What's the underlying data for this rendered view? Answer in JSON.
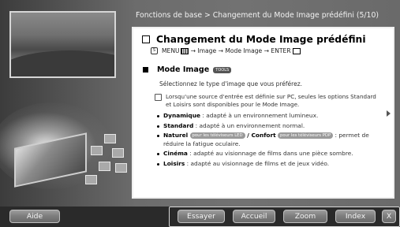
{
  "header": {
    "breadcrumb": "Fonctions de base > Changement du Mode Image prédéfini (5/10)"
  },
  "content": {
    "title": "Changement du Mode Image prédéfini",
    "menu_path": {
      "menu": "MENU",
      "path": "→ Image → Mode Image → ENTER"
    },
    "section_title": "Mode Image",
    "tools_label": "TOOLS",
    "intro": "Sélectionnez le type d'image que vous préférez.",
    "note": "Lorsqu'une source d'entrée est définie sur PC, seules les options Standard et Loisirs sont disponibles pour le Mode Image.",
    "items": [
      {
        "name": "Dynamique",
        "desc": " : adapté à un environnement lumineux."
      },
      {
        "name": "Standard",
        "desc": " : adapté à un environnement normal."
      },
      {
        "name": "Naturel",
        "chip1": "pour les téléviseurs LED",
        "sep": " / ",
        "name2": "Confort",
        "chip2": "pour les téléviseurs PDP",
        "desc": " : permet de réduire la fatigue oculaire."
      },
      {
        "name": "Cinéma",
        "desc": " : adapté au visionnage de films dans une pièce sombre."
      },
      {
        "name": "Loisirs",
        "desc": " : adapté au visionnage de films et de jeux vidéo."
      }
    ]
  },
  "buttons": {
    "help": "Aide",
    "try": "Essayer",
    "home": "Accueil",
    "zoom": "Zoom",
    "index": "Index",
    "close": "X"
  }
}
